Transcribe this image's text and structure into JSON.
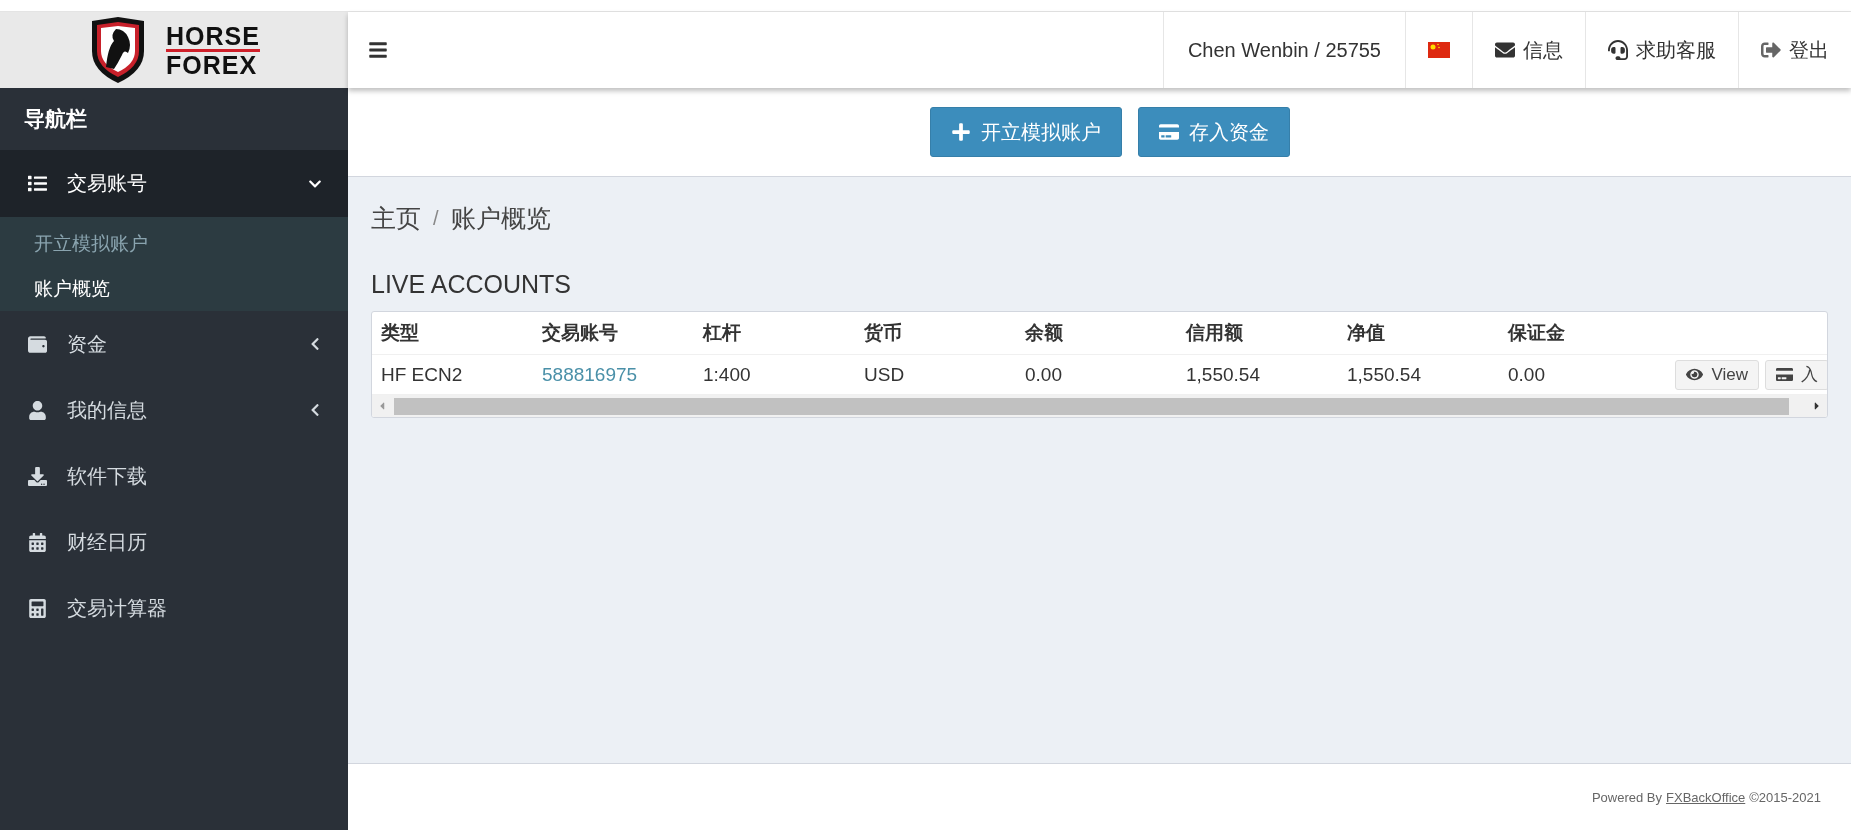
{
  "logo": {
    "line_1": "HORSE",
    "line_2": "FOREX"
  },
  "topbar": {
    "user": "Chen Wenbin / 25755",
    "items": [
      {
        "kind": "flag"
      },
      {
        "kind": "mail",
        "label": "信息"
      },
      {
        "kind": "support",
        "label": "求助客服"
      },
      {
        "kind": "logout",
        "label": "登出"
      }
    ]
  },
  "sidebar": {
    "title": "导航栏",
    "items": [
      {
        "kind": "group",
        "label": "交易账号",
        "expanded": true,
        "children": [
          {
            "label": "开立模拟账户",
            "selected": false
          },
          {
            "label": "账户概览",
            "selected": true
          }
        ]
      },
      {
        "kind": "group",
        "label": "资金",
        "expanded": false
      },
      {
        "kind": "group",
        "label": "我的信息",
        "expanded": false
      },
      {
        "kind": "link",
        "label": "软件下载"
      },
      {
        "kind": "link",
        "label": "财经日历"
      },
      {
        "kind": "link",
        "label": "交易计算器"
      }
    ]
  },
  "action_buttons": [
    {
      "kind": "add",
      "label": "开立模拟账户"
    },
    {
      "kind": "deposit",
      "label": "存入资金"
    }
  ],
  "breadcrumb": {
    "separator": "/",
    "items": [
      "主页",
      "账户概览"
    ]
  },
  "section_title": "LIVE ACCOUNTS",
  "table": {
    "columns": [
      "类型",
      "交易账号",
      "杠杆",
      "货币",
      "余额",
      "信用额",
      "净值",
      "保证金"
    ],
    "rows": [
      {
        "cells": [
          {
            "kind": "text",
            "text": "HF ECN2"
          },
          {
            "kind": "link",
            "text": "588816975"
          },
          {
            "kind": "text",
            "text": "1:400"
          },
          {
            "kind": "text",
            "text": "USD"
          },
          {
            "kind": "text",
            "text": "0.00"
          },
          {
            "kind": "text",
            "text": "1,550.54"
          },
          {
            "kind": "text",
            "text": "1,550.54"
          },
          {
            "kind": "text",
            "text": "0.00"
          }
        ],
        "actions": [
          {
            "kind": "view",
            "label": "View"
          },
          {
            "kind": "deposit",
            "label": "入"
          }
        ]
      }
    ]
  },
  "footer": {
    "prefix": "Powered By",
    "link": "FXBackOffice",
    "suffix": "©2015-2021"
  }
}
